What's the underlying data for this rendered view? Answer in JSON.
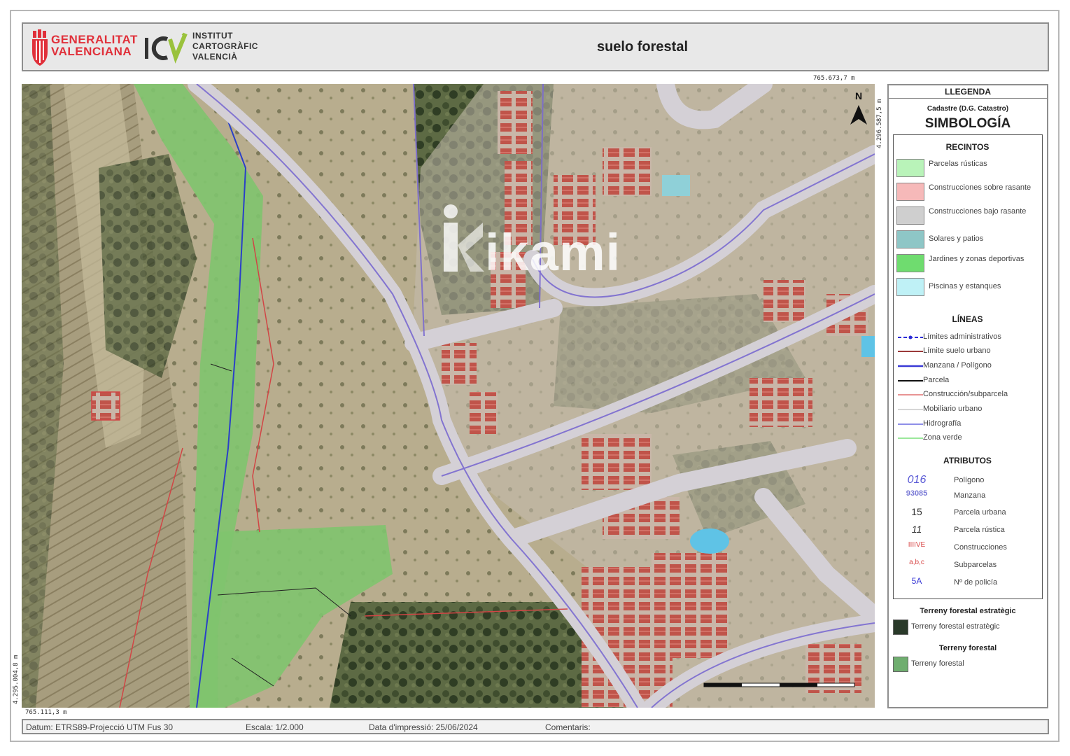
{
  "header": {
    "gva_logo_text": [
      "GENERALITAT",
      "VALENCIANA"
    ],
    "icv_logo_text": [
      "INSTITUT",
      "CARTOGRÀFIC",
      "VALENCIÀ"
    ],
    "title": "suelo forestal"
  },
  "map": {
    "coord_top_right": "765.673,7 m",
    "coord_right_vertical": "4.296.587,5 m",
    "coord_bottom_left": "765.111,3 m",
    "coord_left_vertical": "4.295.004,8 m",
    "north_label": "N",
    "watermark": "ikami"
  },
  "legend": {
    "title": "LLEGENDA",
    "subtitle": "Cadastre (D.G. Catastro)",
    "heading": "SIMBOLOGÍA",
    "recintos": {
      "title": "RECINTOS",
      "items": [
        {
          "label": "Parcelas rústicas",
          "color": "#b9f3b9"
        },
        {
          "label": "Construcciones sobre rasante",
          "color": "#f6b9b9"
        },
        {
          "label": "Construcciones bajo rasante",
          "color": "#cfcfcf"
        },
        {
          "label": "Solares y patios",
          "color": "#8ec6c6"
        },
        {
          "label": "Jardines y zonas deportivas",
          "color": "#6fdc6f"
        },
        {
          "label": "Piscinas y estanques",
          "color": "#bff1f6"
        }
      ]
    },
    "lineas": {
      "title": "LÍNEAS",
      "items": [
        {
          "label": "Límites administrativos",
          "color": "#2b2bd6"
        },
        {
          "label": "Límite suelo urbano",
          "color": "#9b3a3a"
        },
        {
          "label": "Manzana / Polígono",
          "color": "#3a3ad6"
        },
        {
          "label": "Parcela",
          "color": "#111111"
        },
        {
          "label": "Construcción/subparcela",
          "color": "#e07070"
        },
        {
          "label": "Mobiliario urbano",
          "color": "#d6d6d6"
        },
        {
          "label": "Hidrografía",
          "color": "#6a6ae0"
        },
        {
          "label": "Zona verde",
          "color": "#7ae07a"
        }
      ]
    },
    "atributos": {
      "title": "ATRIBUTOS",
      "items": [
        {
          "symbol": "016",
          "label": "Polígono",
          "color": "#5a5ad6"
        },
        {
          "symbol": "93085",
          "label": "Manzana",
          "color": "#7a7ad6"
        },
        {
          "symbol": "15",
          "label": "Parcela urbana",
          "color": "#333333"
        },
        {
          "symbol": "11",
          "label": "Parcela rústica",
          "color": "#333333"
        },
        {
          "symbol": "IIIIVE",
          "label": "Construcciones",
          "color": "#d84848"
        },
        {
          "symbol": "a,b,c",
          "label": "Subparcelas",
          "color": "#d84848"
        },
        {
          "symbol": "5A",
          "label": "Nº de policía",
          "color": "#3a3ad6"
        }
      ]
    },
    "forest_strategic": {
      "title": "Terreny forestal estratègic",
      "label": "Terreny forestal estratègic",
      "color": "#2a3a2a"
    },
    "forest": {
      "title": "Terreny forestal",
      "label": "Terreny forestal",
      "color": "#6fae6f"
    }
  },
  "footer": {
    "datum": "Datum: ETRS89-Projecció UTM Fus 30",
    "scale": "Escala: 1/2.000",
    "date": "Data d'impressió: 25/06/2024",
    "comment": "Comentaris:"
  }
}
